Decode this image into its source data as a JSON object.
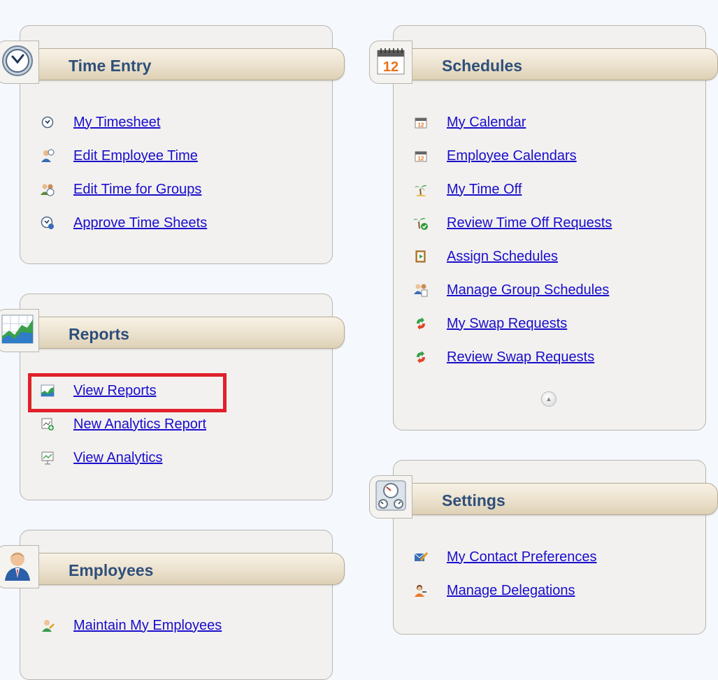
{
  "time_entry": {
    "title": "Time Entry",
    "icon": "clock-icon",
    "links": [
      {
        "label": "My Timesheet",
        "icon": "clock-icon"
      },
      {
        "label": "Edit Employee Time",
        "icon": "employee-clock-icon"
      },
      {
        "label": "Edit Time for Groups",
        "icon": "group-clock-icon"
      },
      {
        "label": "Approve Time Sheets",
        "icon": "approve-clock-icon"
      }
    ]
  },
  "reports": {
    "title": "Reports",
    "icon": "chart-icon",
    "links": [
      {
        "label": "View Reports",
        "icon": "chart-icon"
      },
      {
        "label": "New Analytics Report",
        "icon": "new-analytics-icon"
      },
      {
        "label": "View Analytics",
        "icon": "analytics-board-icon"
      }
    ]
  },
  "employees": {
    "title": "Employees",
    "icon": "employee-icon",
    "links": [
      {
        "label": "Maintain My Employees",
        "icon": "employee-edit-icon"
      }
    ]
  },
  "schedules": {
    "title": "Schedules",
    "icon": "calendar-icon",
    "header_icon_text": "12",
    "links": [
      {
        "label": "My Calendar",
        "icon": "calendar-icon"
      },
      {
        "label": "Employee Calendars",
        "icon": "calendar-icon"
      },
      {
        "label": "My Time Off",
        "icon": "palm-tree-icon"
      },
      {
        "label": "Review Time Off Requests",
        "icon": "palm-tree-check-icon"
      },
      {
        "label": "Assign Schedules",
        "icon": "assign-schedule-icon"
      },
      {
        "label": "Manage Group Schedules",
        "icon": "group-schedule-icon"
      },
      {
        "label": "My Swap Requests",
        "icon": "swap-icon"
      },
      {
        "label": "Review Swap Requests",
        "icon": "swap-icon"
      }
    ]
  },
  "settings": {
    "title": "Settings",
    "icon": "gauges-icon",
    "links": [
      {
        "label": "My Contact Preferences",
        "icon": "contact-edit-icon"
      },
      {
        "label": "Manage Delegations",
        "icon": "delegation-icon"
      }
    ]
  },
  "colors": {
    "link": "#1a0dcc",
    "header_title": "#2f4f7a",
    "highlight": "#e0202a",
    "panel_bg": "#f2f1ef",
    "page_bg": "#f5f8fc"
  }
}
